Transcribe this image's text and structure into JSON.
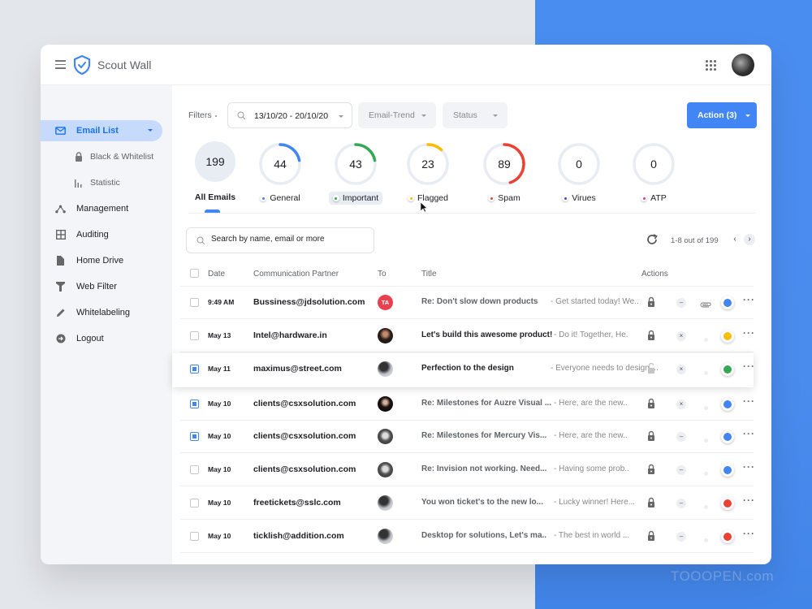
{
  "app": {
    "title": "Scout Wall",
    "brand_color": "#4285f4",
    "watermark": "TOOOPEN.com"
  },
  "sidebar": {
    "items": [
      {
        "label": "Email List",
        "icon": "mail-icon",
        "active": true,
        "expanded": true
      },
      {
        "label": "Black & Whitelist",
        "icon": "lock-icon",
        "sub": true
      },
      {
        "label": "Statistic",
        "icon": "bar-chart-icon",
        "sub": true
      },
      {
        "label": "Management",
        "icon": "share-nodes-icon"
      },
      {
        "label": "Auditing",
        "icon": "grid-icon"
      },
      {
        "label": "Home Drive",
        "icon": "file-icon"
      },
      {
        "label": "Web Filter",
        "icon": "filter-icon"
      },
      {
        "label": "Whitelabeling",
        "icon": "pencil-icon"
      },
      {
        "label": "Logout",
        "icon": "logout-icon"
      }
    ]
  },
  "filters": {
    "label": "Filters",
    "date_range": "13/10/20 - 20/10/20",
    "email_trend": "Email-Trend",
    "status": "Status",
    "action_button": "Action (3)"
  },
  "stats": [
    {
      "label": "All Emails",
      "count": "199"
    },
    {
      "label": "General",
      "count": "44",
      "color": "#4285f4",
      "fraction": 0.22
    },
    {
      "label": "Important",
      "count": "43",
      "color": "#34a853",
      "fraction": 0.22
    },
    {
      "label": "Flagged",
      "count": "23",
      "color": "#fbbc05",
      "fraction": 0.12
    },
    {
      "label": "Spam",
      "count": "89",
      "color": "#ea4335",
      "fraction": 0.45
    },
    {
      "label": "Virues",
      "count": "0",
      "color": "#5b3fd9",
      "fraction": 0
    },
    {
      "label": "ATP",
      "count": "0",
      "color": "#d63ab0",
      "fraction": 0
    }
  ],
  "search": {
    "placeholder": "Search by name, email or more"
  },
  "pager": {
    "text": "1-8 out of 199",
    "prev": "‹",
    "next": "›"
  },
  "table": {
    "columns": [
      "Date",
      "Communication Partner",
      "To",
      "Title",
      "Actions"
    ],
    "rows": [
      {
        "checked": false,
        "date": "9:49 AM",
        "partner": "Bussiness@jdsolution.com",
        "to": "TA",
        "to_type": "initials",
        "title": "Re: Don't slow down products",
        "snippet": "- Get started today! We..",
        "locked": true,
        "status": "minus",
        "attachment": true,
        "color": "#4285f4"
      },
      {
        "checked": false,
        "date": "May 13",
        "partner": "Intel@hardware.in",
        "to_type": "photo1",
        "title": "Let's build this awesome product!",
        "snippet": "- Do it! Together, He.",
        "locked": true,
        "status": "x",
        "attachment": false,
        "color": "#fbbc05",
        "dark_title": true
      },
      {
        "checked": true,
        "date": "May 11",
        "partner": "maximus@street.com",
        "to_type": "photo2",
        "title": "Perfection to the design",
        "snippet": "- Everyone needs to design ...",
        "locked": false,
        "status": "x",
        "attachment": false,
        "color": "#34a853",
        "dark_title": true,
        "elevated": true
      },
      {
        "checked": true,
        "date": "May 10",
        "partner": "clients@csxsolution.com",
        "to_type": "photo3",
        "title": "Re: Milestones for Auzre Visual ...",
        "snippet": "- Here, are the new..",
        "locked": true,
        "status": "x",
        "attachment": false,
        "color": "#4285f4"
      },
      {
        "checked": true,
        "date": "May 10",
        "partner": "clients@csxsolution.com",
        "to_type": "photo4",
        "title": "Re: Milestones for Mercury Vis...",
        "snippet": "- Here, are the new..",
        "locked": true,
        "status": "minus",
        "attachment": false,
        "color": "#4285f4"
      },
      {
        "checked": false,
        "date": "May 10",
        "partner": "clients@csxsolution.com",
        "to_type": "photo4",
        "title": "Re: Invision not working. Need...",
        "snippet": "- Having some prob..",
        "locked": true,
        "status": "minus",
        "attachment": false,
        "color": "#4285f4"
      },
      {
        "checked": false,
        "date": "May 10",
        "partner": "freetickets@sslc.com",
        "to_type": "photo2",
        "title": "You won ticket's to the new lo...",
        "snippet": "- Lucky winner! Here...",
        "locked": true,
        "status": "minus",
        "attachment": false,
        "color": "#ea4335"
      },
      {
        "checked": false,
        "date": "May 10",
        "partner": "ticklish@addition.com",
        "to_type": "photo2",
        "title": "Desktop for solutions, Let's ma..",
        "snippet": "- The best in world ...",
        "locked": true,
        "status": "minus",
        "attachment": false,
        "color": "#ea4335"
      }
    ]
  }
}
